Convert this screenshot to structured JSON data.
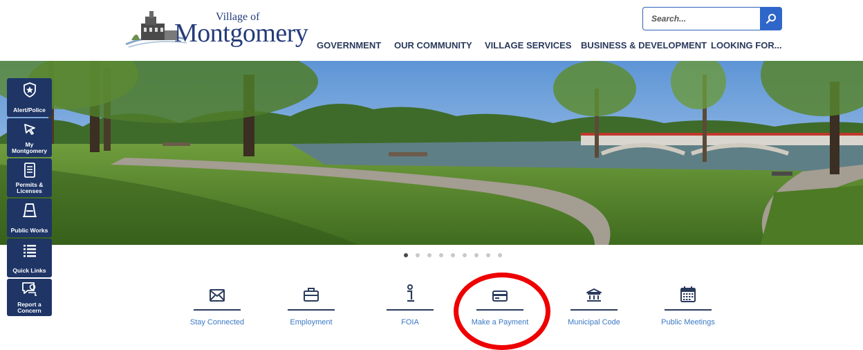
{
  "header": {
    "logo_small": "Village of",
    "logo_large": "Montgomery"
  },
  "search": {
    "placeholder": "Search..."
  },
  "nav": [
    {
      "label": "GOVERNMENT"
    },
    {
      "label": "OUR COMMUNITY"
    },
    {
      "label": "VILLAGE SERVICES"
    },
    {
      "label": "BUSINESS & DEVELOPMENT"
    },
    {
      "label": "LOOKING FOR..."
    }
  ],
  "rail": [
    {
      "label": "Alert/Police",
      "icon": "shield-star-icon"
    },
    {
      "label": "My Montgomery",
      "icon": "cursor-arrow-icon"
    },
    {
      "label": "Permits & Licenses",
      "icon": "document-icon"
    },
    {
      "label": "Public Works",
      "icon": "road-icon"
    },
    {
      "label": "Quick Links",
      "icon": "list-icon"
    },
    {
      "label": "Report a Concern",
      "icon": "chat-icon"
    }
  ],
  "slider": {
    "slides": 9,
    "active": 1
  },
  "quick_links": [
    {
      "label": "Stay Connected",
      "icon": "envelope-icon"
    },
    {
      "label": "Employment",
      "icon": "briefcase-icon"
    },
    {
      "label": "FOIA",
      "icon": "info-icon"
    },
    {
      "label": "Make a Payment",
      "icon": "credit-card-icon"
    },
    {
      "label": "Municipal Code",
      "icon": "bank-icon"
    },
    {
      "label": "Public Meetings",
      "icon": "calendar-icon"
    }
  ],
  "colors": {
    "brand_navy": "#1e3566",
    "link_blue": "#3a78c4",
    "search_blue": "#2f66c9",
    "highlight_red": "#ee0000"
  }
}
